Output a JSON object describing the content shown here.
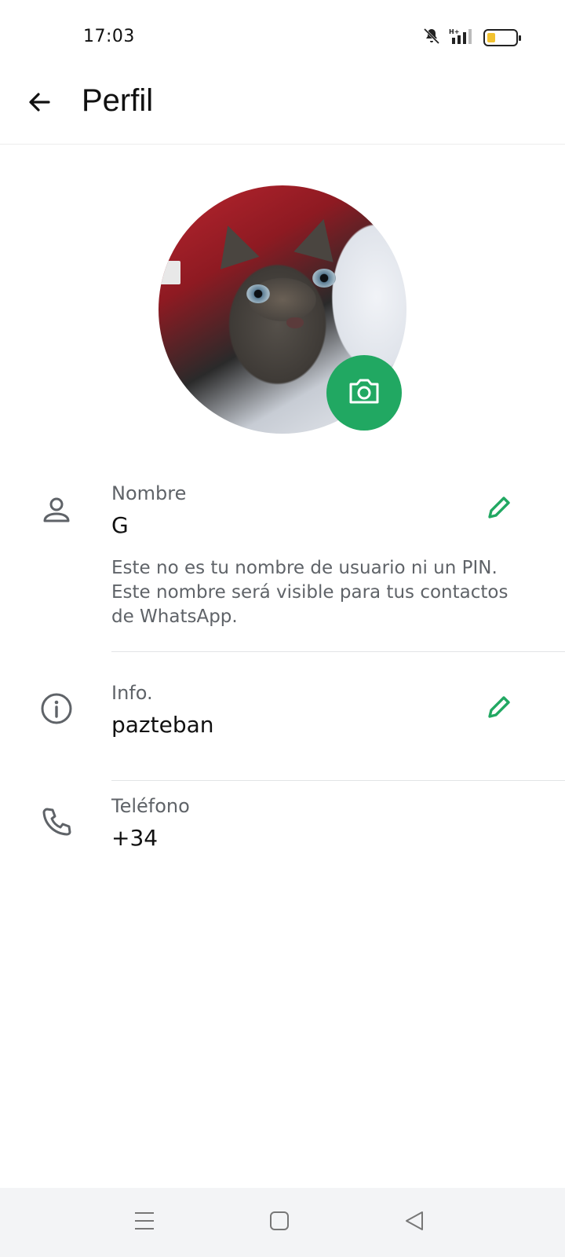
{
  "status_bar": {
    "time": "17:03",
    "icons": [
      "bell-muted-icon",
      "signal-icon",
      "battery-icon"
    ],
    "battery_level": 0.3
  },
  "header": {
    "title": "Perfil",
    "back_icon": "arrow-left-icon"
  },
  "profile": {
    "photo_description_icon": "profile-photo",
    "camera_icon": "camera-icon",
    "accent_color": "#21a862"
  },
  "fields": {
    "name": {
      "label": "Nombre",
      "value": "G",
      "hint": "Este no es tu nombre de usuario ni un PIN. Este nombre será visible para tus contactos de WhatsApp.",
      "icon": "person-icon",
      "edit_icon": "pencil-icon"
    },
    "about": {
      "label": "Info.",
      "value": "pazteban",
      "icon": "info-icon",
      "edit_icon": "pencil-icon"
    },
    "phone": {
      "label": "Teléfono",
      "value": "+34",
      "icon": "phone-icon"
    }
  },
  "nav_bar": {
    "buttons": [
      "menu-icon",
      "home-icon",
      "back-triangle-icon"
    ]
  }
}
